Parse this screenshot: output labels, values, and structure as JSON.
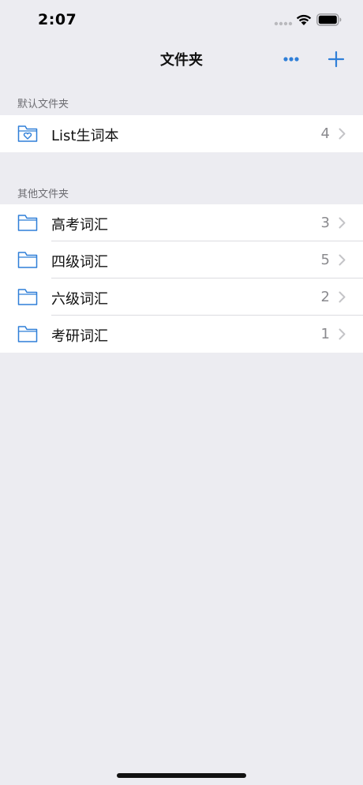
{
  "status_bar": {
    "time": "2:07"
  },
  "nav": {
    "title": "文件夹",
    "more_icon": "ellipsis-icon",
    "add_icon": "plus-icon"
  },
  "colors": {
    "accent": "#2f7fd8",
    "background": "#ececf1",
    "secondary_text": "#8a8a8e"
  },
  "sections": [
    {
      "header": "默认文件夹",
      "items": [
        {
          "label": "List生词本",
          "count": "4",
          "icon": "heart-folder-icon"
        }
      ]
    },
    {
      "header": "其他文件夹",
      "items": [
        {
          "label": "高考词汇",
          "count": "3",
          "icon": "folder-icon"
        },
        {
          "label": "四级词汇",
          "count": "5",
          "icon": "folder-icon"
        },
        {
          "label": "六级词汇",
          "count": "2",
          "icon": "folder-icon"
        },
        {
          "label": "考研词汇",
          "count": "1",
          "icon": "folder-icon"
        }
      ]
    }
  ]
}
